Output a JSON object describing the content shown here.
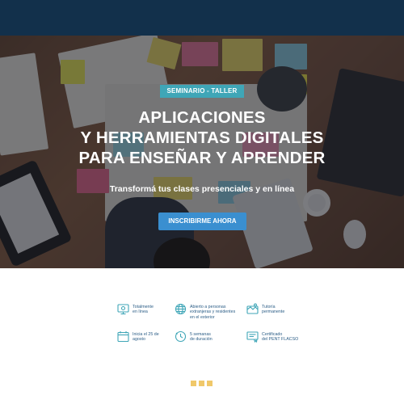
{
  "hero": {
    "badge": "SEMINARIO - TALLER",
    "title_lines": [
      "APLICACIONES",
      "Y HERRAMIENTAS DIGITALES",
      "PARA ENSEÑAR Y APRENDER"
    ],
    "subtitle": "Transformá tus clases presenciales y en línea",
    "cta_label": "INSCRIBIRME AHORA"
  },
  "features": [
    {
      "icon": "monitor-icon",
      "text": "Totalmente\nen línea"
    },
    {
      "icon": "globe-icon",
      "text": "Abierto a personas\nextranjeras y residentes\nen el exterior"
    },
    {
      "icon": "tutoring-icon",
      "text": "Tutoría\npermanente"
    },
    {
      "icon": "calendar-icon",
      "text": "Inicia el 25 de\nagosto"
    },
    {
      "icon": "clock-icon",
      "text": "5 semanas\nde duración"
    },
    {
      "icon": "certificate-icon",
      "text": "Certificado\ndel PENT FLACSO"
    }
  ],
  "colors": {
    "topbar": "#12304b",
    "badge": "#3fa6b7",
    "cta": "#3a8fd0",
    "feature_text": "#2b5d86",
    "feature_icon": "#3fa6b7",
    "slider_dot": "#f0c86a"
  }
}
